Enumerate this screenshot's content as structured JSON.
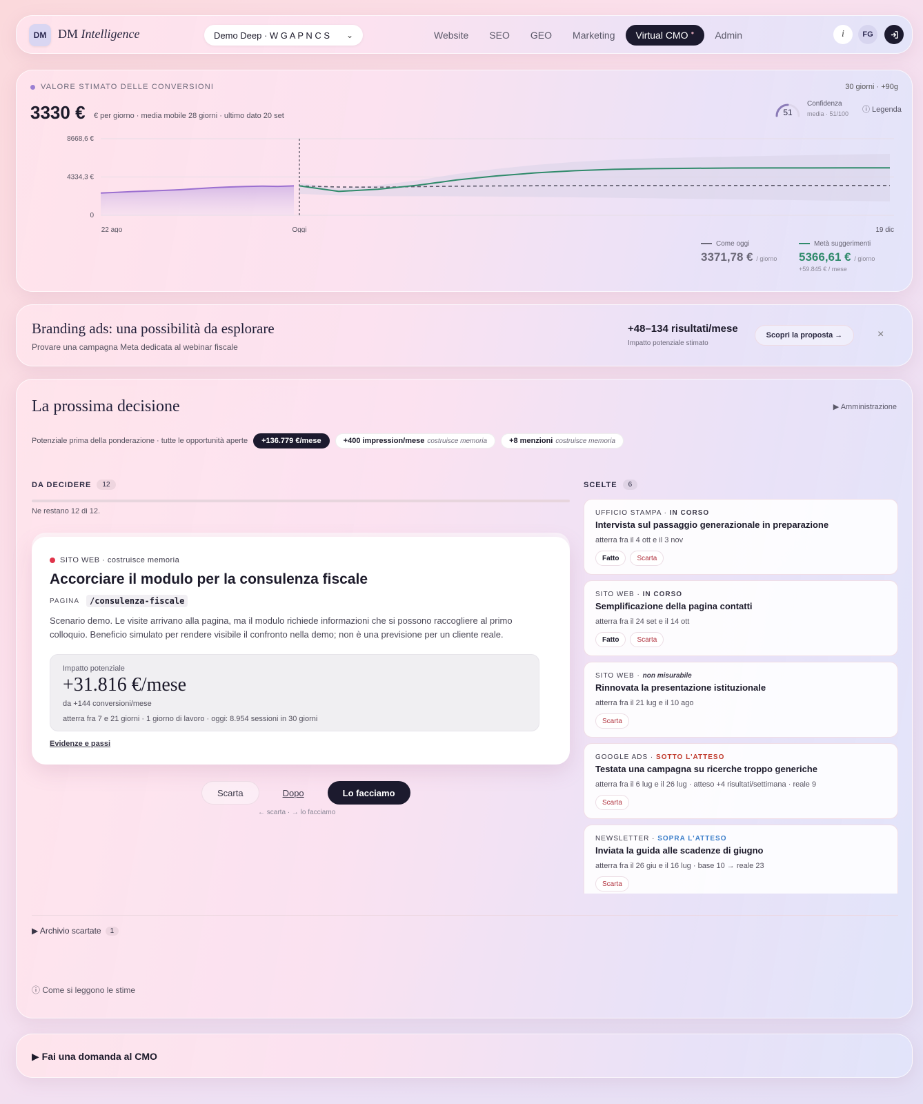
{
  "header": {
    "logo_badge": "DM",
    "logo_text": "DM",
    "logo_text_italic": "Intelligence",
    "workspace": "Demo Deep · W G A P N C S",
    "nav": [
      {
        "label": "Website",
        "active": false
      },
      {
        "label": "SEO",
        "active": false
      },
      {
        "label": "GEO",
        "active": false
      },
      {
        "label": "Marketing",
        "active": false
      },
      {
        "label": "Virtual CMO",
        "active": true
      },
      {
        "label": "Admin",
        "active": false
      }
    ],
    "info": "i",
    "avatar": "FG"
  },
  "chart_section": {
    "label": "VALORE STIMATO DELLE CONVERSIONI",
    "period": "30 giorni · +90g",
    "value": "3330 €",
    "value_sub": "€ per giorno · media mobile 28 giorni · ultimo dato 20 set",
    "confidence_value": "51",
    "confidence_label": "Confidenza",
    "confidence_sub": "media · 51/100",
    "legend_link": "ⓘ Legenda",
    "legend_today": "Come oggi",
    "value_today": "3371,78 €",
    "per_day_today": "/ giorno",
    "legend_half": "Metà suggerimenti",
    "value_half": "5366,61 €",
    "per_day_half": "/ giorno",
    "month_half": "+59.845 € / mese"
  },
  "chart_data": {
    "type": "line",
    "xlabels": [
      "22 ago",
      "Oggi",
      "19 dic"
    ],
    "ylabels": [
      "8668,6 €",
      "4334,3 €",
      "0"
    ],
    "ylim": [
      0,
      8668.6
    ],
    "grid": true,
    "colors": {
      "history": "#9b6fd0",
      "today": "#5a5868",
      "half": "#2f8a6a",
      "band": "#d9d3e8"
    },
    "series": [
      {
        "name": "",
        "values": [
          2520,
          2600,
          2680,
          2750,
          2820,
          2900,
          3020,
          3120,
          3200,
          3260,
          3300,
          3270,
          3330
        ]
      },
      {
        "name": "Come oggi",
        "values": [
          3330,
          3200,
          3180,
          3240,
          3290,
          3320,
          3340,
          3350,
          3360,
          3365,
          3368,
          3369,
          3370,
          3371,
          3371,
          3371.78
        ]
      },
      {
        "name": "Metà suggerimenti",
        "values": [
          3330,
          2700,
          2950,
          3400,
          4000,
          4450,
          4800,
          5050,
          5200,
          5280,
          5320,
          5345,
          5355,
          5362,
          5365,
          5366.61
        ]
      }
    ]
  },
  "suggestion": {
    "title": "Branding ads: una possibilità da esplorare",
    "subtitle": "Provare una campagna Meta dedicata al webinar fiscale",
    "impact": "+48–134 risultati/mese",
    "impact_sub": "Impatto potenziale stimato",
    "button": "Scopri la proposta →",
    "close": "×"
  },
  "decisions": {
    "title": "La prossima decisione",
    "admin_link": "▶ Amministrazione",
    "potential_text": "Potenziale prima della ponderazione · tutte le opportunità aperte",
    "pills": [
      {
        "bold": "+136.779 €/mese",
        "italic": ""
      },
      {
        "bold": "+400 impression/mese",
        "italic": "costruisce memoria"
      },
      {
        "bold": "+8 menzioni",
        "italic": "costruisce memoria"
      }
    ],
    "to_decide_label": "DA DECIDERE",
    "to_decide_count": "12",
    "remaining": "Ne restano 12 di 12.",
    "chosen_label": "SCELTE",
    "chosen_count": "6",
    "card": {
      "category": "SITO WEB · costruisce memoria",
      "title": "Accorciare il modulo per la consulenza fiscale",
      "page_label": "PAGINA",
      "page_path": "/consulenza-fiscale",
      "description": "Scenario demo. Le visite arrivano alla pagina, ma il modulo richiede informazioni che si possono raccogliere al primo colloquio. Beneficio simulato per rendere visibile il confronto nella demo; non è una previsione per un cliente reale.",
      "impact_label": "Impatto potenziale",
      "impact_value": "+31.816 €/mese",
      "impact_sub": "da +144 conversioni/mese",
      "impact_foot": "atterra fra 7 e 21 giorni · 1 giorno di lavoro · oggi: 8.954 sessioni in 30 giorni",
      "evidence_link": "Evidenze e passi"
    },
    "actions": {
      "discard": "Scarta",
      "later": "Dopo",
      "do": "Lo facciamo",
      "hint": "← scarta · → lo facciamo"
    },
    "choices": [
      {
        "cat": "UFFICIO STAMPA · ",
        "status": "IN CORSO",
        "style": "",
        "title": "Intervista sul passaggio generazionale in preparazione",
        "date": "atterra fra il 4 ott e il 3 nov",
        "done": "Fatto",
        "discard": "Scarta"
      },
      {
        "cat": "SITO WEB · ",
        "status": "IN CORSO",
        "style": "",
        "title": "Semplificazione della pagina contatti",
        "date": "atterra fra il 24 set e il 14 ott",
        "done": "Fatto",
        "discard": "Scarta"
      },
      {
        "cat": "SITO WEB · ",
        "status": "non misurabile",
        "style": "it",
        "title": "Rinnovata la presentazione istituzionale",
        "date": "atterra fra il 21 lug e il 10 ago",
        "done": "",
        "discard": "Scarta"
      },
      {
        "cat": "GOOGLE ADS · ",
        "status": "SOTTO L'ATTESO",
        "style": "red",
        "title": "Testata una campagna su ricerche troppo generiche",
        "date": "atterra fra il 6 lug e il 26 lug · atteso +4 risultati/settimana · reale 9",
        "done": "",
        "discard": "Scarta"
      },
      {
        "cat": "NEWSLETTER · ",
        "status": "SOPRA L'ATTESO",
        "style": "blue",
        "title": "Inviata la guida alle scadenze di giugno",
        "date": "atterra fra il 26 giu e il 16 lug · base 10 → reale 23",
        "done": "",
        "discard": "Scarta"
      }
    ],
    "archive": "▶ Archivio scartate",
    "archive_count": "1",
    "how": "ⓘ Come si leggono le stime"
  },
  "ask": {
    "label": "▶ Fai una domanda al CMO"
  }
}
